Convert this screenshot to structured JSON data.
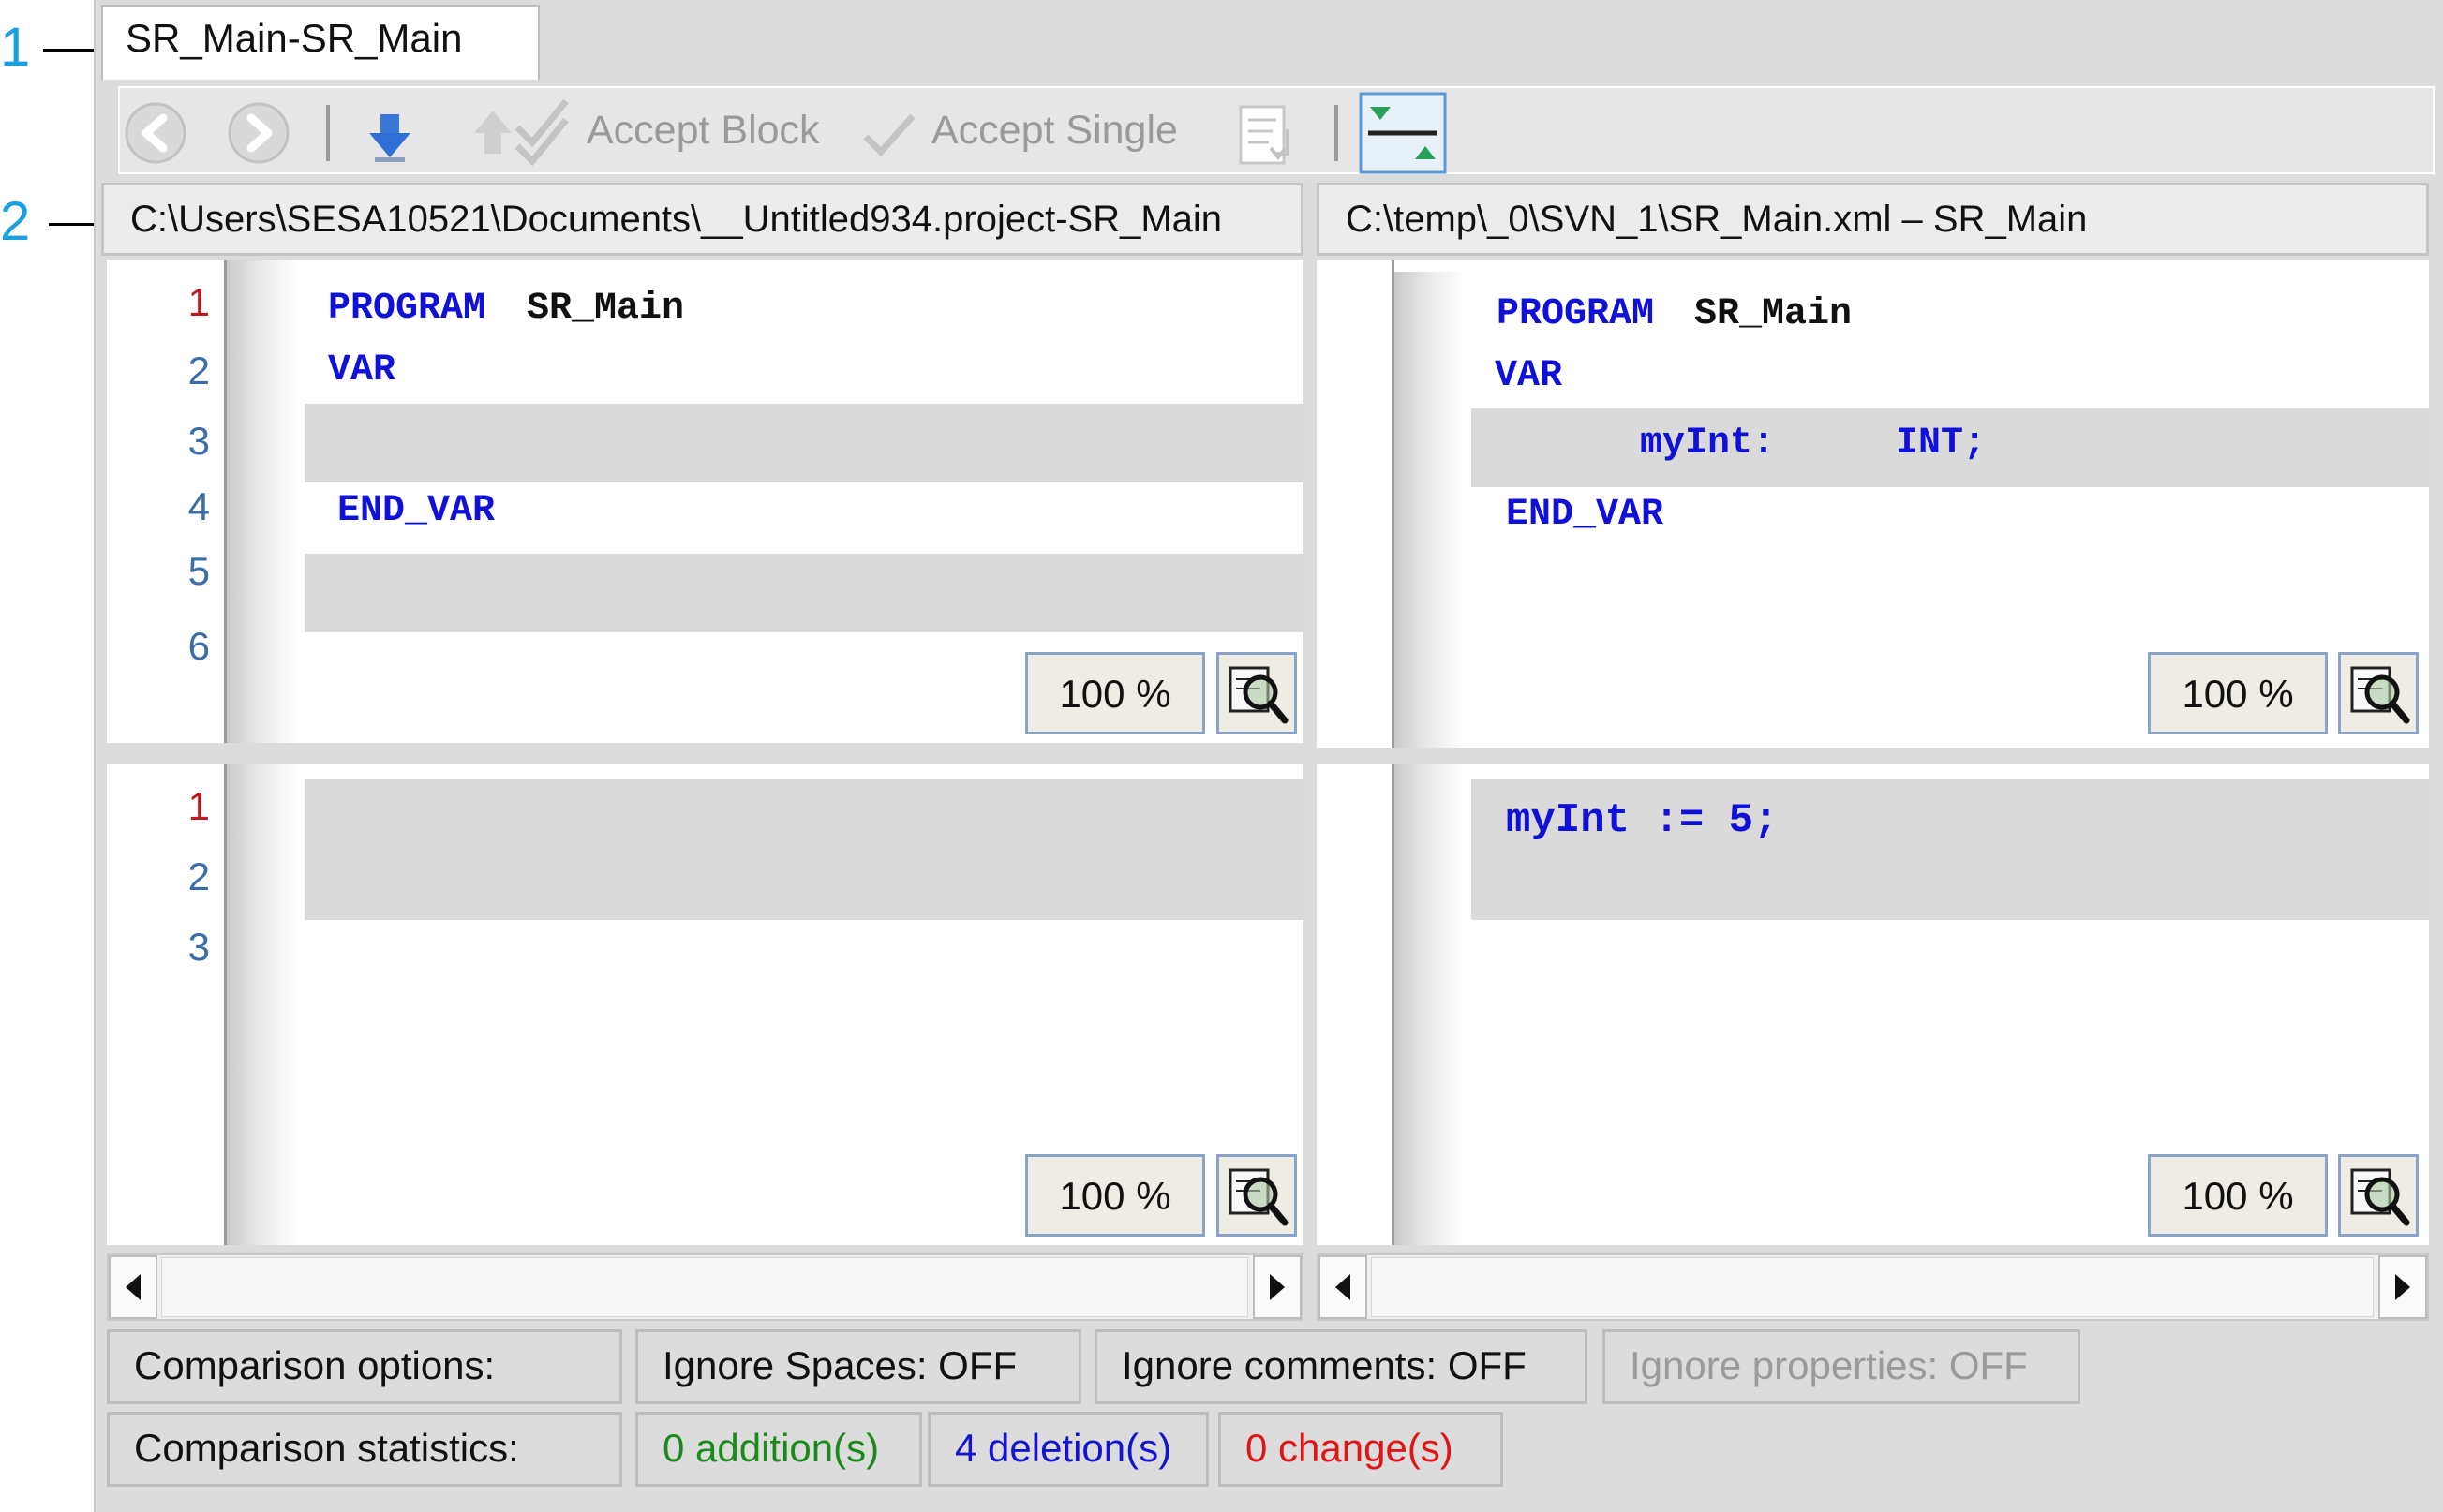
{
  "callouts": [
    "1",
    "2"
  ],
  "tab": {
    "title": "SR_Main-SR_Main"
  },
  "toolbar": {
    "accept_block": "Accept Block",
    "accept_single": "Accept Single"
  },
  "left": {
    "path": "C:\\Users\\SESA10521\\Documents\\__Untitled934.project-SR_Main",
    "decl_line_numbers": [
      "1",
      "2",
      "3",
      "4",
      "5",
      "6"
    ],
    "impl_line_numbers": [
      "1",
      "2",
      "3"
    ],
    "decl": {
      "kw_program": "PROGRAM",
      "name": "SR_Main",
      "kw_var": "VAR",
      "kw_end_var": "END_VAR"
    },
    "zoom_top": "100 %",
    "zoom_bottom": "100 %"
  },
  "right": {
    "path": "C:\\temp\\_0\\SVN_1\\SR_Main.xml – SR_Main",
    "decl": {
      "kw_program": "PROGRAM",
      "name": "SR_Main",
      "kw_var": "VAR",
      "var_name": "myInt:",
      "var_type": "INT;",
      "kw_end_var": "END_VAR"
    },
    "impl": {
      "line1": "myInt := 5;"
    },
    "zoom_top": "100 %",
    "zoom_bottom": "100 %"
  },
  "options": {
    "label": "Comparison options:",
    "ignore_spaces": "Ignore Spaces: OFF",
    "ignore_comments": "Ignore comments: OFF",
    "ignore_properties": "Ignore properties: OFF"
  },
  "statistics": {
    "label": "Comparison statistics:",
    "additions": "0 addition(s)",
    "deletions": "4 deletion(s)",
    "changes": "0 change(s)"
  },
  "colors": {
    "addition": "#1a8a1a",
    "deletion": "#1515d0",
    "change": "#e01515",
    "keyword": "#1010d8",
    "callout": "#1aa0e0"
  }
}
